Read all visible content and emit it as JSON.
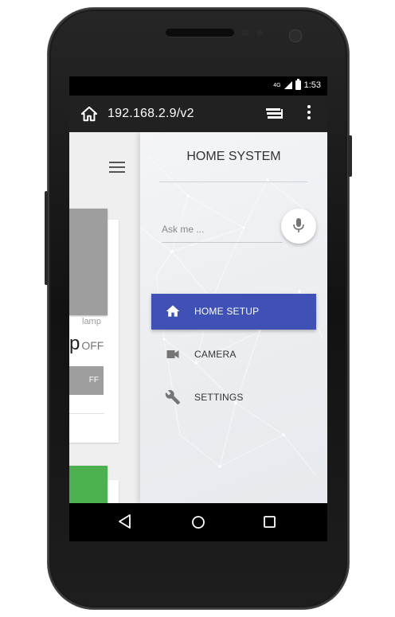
{
  "status_bar": {
    "network": "4G",
    "time": "1:53"
  },
  "browser": {
    "url": "192.168.2.9/v2",
    "home_icon": "home-icon",
    "tabs_icon": "tabs-icon",
    "menu_icon": "more-vert-icon"
  },
  "background_page": {
    "card": {
      "caption": "lamp",
      "title_fragment": "p",
      "state": "OFF",
      "button_fragment": "FF"
    }
  },
  "drawer": {
    "title": "HOME SYSTEM",
    "search": {
      "placeholder": "Ask me ...",
      "value": "",
      "mic_icon": "mic-icon"
    },
    "menu": [
      {
        "label": "HOME SETUP",
        "icon": "home-icon",
        "active": true
      },
      {
        "label": "CAMERA",
        "icon": "videocam-icon",
        "active": false
      },
      {
        "label": "SETTINGS",
        "icon": "wrench-icon",
        "active": false
      }
    ],
    "colors": {
      "active_bg": "#3f51b5",
      "active_text": "#ffffff",
      "text": "#333333"
    }
  },
  "nav_bar": {
    "back_icon": "back-icon",
    "home_icon": "home-circle-icon",
    "recent_icon": "recent-apps-icon"
  }
}
